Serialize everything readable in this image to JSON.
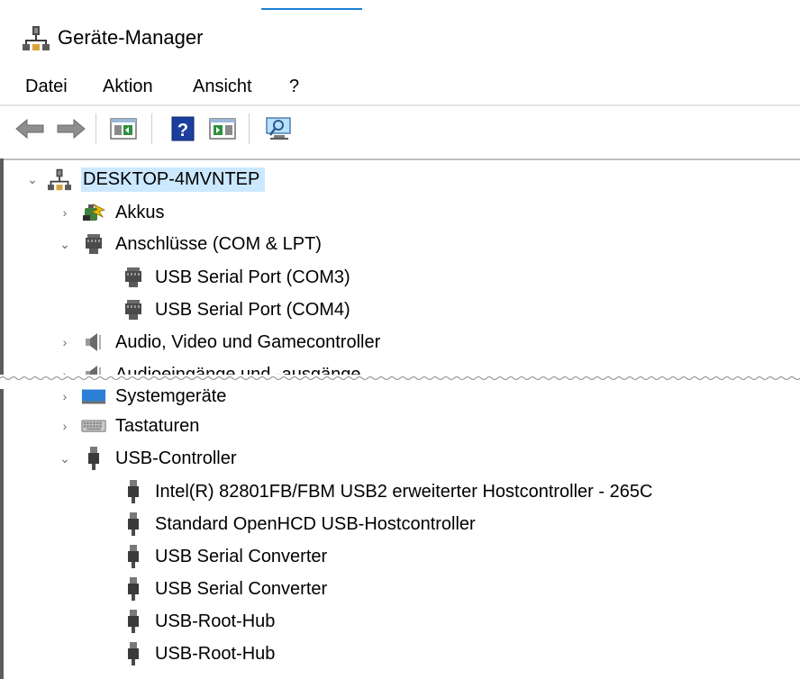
{
  "window": {
    "title": "Geräte-Manager"
  },
  "menu": {
    "items": [
      "Datei",
      "Aktion",
      "Ansicht",
      "?"
    ]
  },
  "toolbar": {
    "buttons": [
      {
        "icon": "back-arrow-icon"
      },
      {
        "icon": "forward-arrow-icon"
      },
      {
        "icon": "properties-panel-icon"
      },
      {
        "icon": "help-icon"
      },
      {
        "icon": "update-driver-panel-icon"
      },
      {
        "icon": "scan-hardware-monitor-icon"
      }
    ]
  },
  "tree": {
    "root": {
      "label": "DESKTOP-4MVNTEP",
      "expanded": true,
      "icon": "computer-icon"
    },
    "upper": [
      {
        "label": "Akkus",
        "expanded": false,
        "level": 1,
        "icon": "battery-icon"
      },
      {
        "label": "Anschlüsse (COM & LPT)",
        "expanded": true,
        "level": 1,
        "icon": "port-icon"
      },
      {
        "label": "USB Serial Port (COM3)",
        "level": 2,
        "icon": "port-icon"
      },
      {
        "label": "USB Serial Port (COM4)",
        "level": 2,
        "icon": "port-icon"
      },
      {
        "label": "Audio, Video und Gamecontroller",
        "expanded": false,
        "level": 1,
        "icon": "speaker-icon"
      },
      {
        "label": "Audioeingänge und -ausgänge",
        "expanded": false,
        "level": 1,
        "icon": "speaker-icon"
      }
    ],
    "lower": [
      {
        "label": "Systemgeräte",
        "expanded": false,
        "level": 1,
        "icon": "system-devices-icon"
      },
      {
        "label": "Tastaturen",
        "expanded": false,
        "level": 1,
        "icon": "keyboard-icon"
      },
      {
        "label": "USB-Controller",
        "expanded": true,
        "level": 1,
        "icon": "usb-plug-icon"
      },
      {
        "label": "Intel(R) 82801FB/FBM USB2 erweiterter Hostcontroller - 265C",
        "level": 2,
        "icon": "usb-plug-icon"
      },
      {
        "label": "Standard OpenHCD USB-Hostcontroller",
        "level": 2,
        "icon": "usb-plug-icon"
      },
      {
        "label": "USB Serial Converter",
        "level": 2,
        "icon": "usb-plug-icon"
      },
      {
        "label": "USB Serial Converter",
        "level": 2,
        "icon": "usb-plug-icon"
      },
      {
        "label": "USB-Root-Hub",
        "level": 2,
        "icon": "usb-plug-icon"
      },
      {
        "label": "USB-Root-Hub",
        "level": 2,
        "icon": "usb-plug-icon"
      }
    ]
  }
}
